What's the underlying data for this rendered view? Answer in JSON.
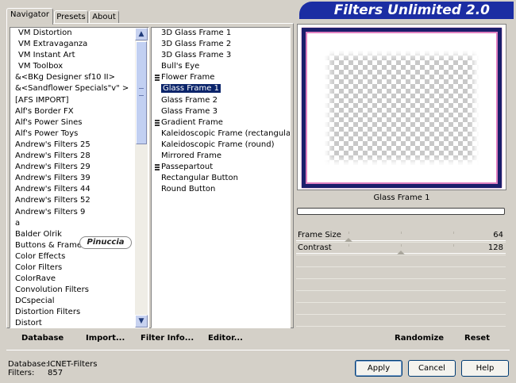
{
  "title": "Filters Unlimited 2.0",
  "tabs": [
    {
      "label": "Navigator",
      "active": true
    },
    {
      "label": "Presets",
      "active": false
    },
    {
      "label": "About",
      "active": false
    }
  ],
  "categories": [
    "VM Distortion",
    "VM Extravaganza",
    "VM Instant Art",
    "VM Toolbox",
    "&<BKg Designer sf10 II>",
    "&<Sandflower Specials\"v\" >",
    "[AFS IMPORT]",
    "Alf's Border FX",
    "Alf's Power Sines",
    "Alf's Power Toys",
    "Andrew's Filters 25",
    "Andrew's Filters 28",
    "Andrew's Filters 29",
    "Andrew's Filters 39",
    "Andrew's Filters 44",
    "Andrew's Filters 52",
    "Andrew's Filters 9",
    "a",
    "Balder Olrik",
    "Buttons & Frames",
    "Color Effects",
    "Color Filters",
    "ColorRave",
    "Convolution Filters",
    "DCspecial",
    "Distortion Filters",
    "Distort"
  ],
  "selected_category": "Buttons & Frames",
  "filters": [
    {
      "label": "3D Glass Frame 1",
      "group": false
    },
    {
      "label": "3D Glass Frame 2",
      "group": false
    },
    {
      "label": "3D Glass Frame 3",
      "group": false
    },
    {
      "label": "Bull's Eye",
      "group": false
    },
    {
      "label": "Flower Frame",
      "group": true
    },
    {
      "label": "Glass Frame 1",
      "group": false,
      "selected": true
    },
    {
      "label": "Glass Frame 2",
      "group": false
    },
    {
      "label": "Glass Frame 3",
      "group": false
    },
    {
      "label": "Gradient Frame",
      "group": true
    },
    {
      "label": "Kaleidoscopic Frame (rectangular)",
      "group": false
    },
    {
      "label": "Kaleidoscopic Frame (round)",
      "group": false
    },
    {
      "label": "Mirrored Frame",
      "group": false
    },
    {
      "label": "Passepartout",
      "group": true
    },
    {
      "label": "Rectangular Button",
      "group": false
    },
    {
      "label": "Round Button",
      "group": false
    }
  ],
  "watermark": "Pinuccia",
  "preview": {
    "filter_name": "Glass Frame 1",
    "frame_color": "#1b1d6b",
    "glow_color": "#e080c0"
  },
  "params": [
    {
      "label": "Frame Size",
      "value": "64",
      "level": 0.25
    },
    {
      "label": "Contrast",
      "value": "128",
      "level": 0.5
    }
  ],
  "left_buttons": {
    "database": "Database",
    "import": "Import...",
    "filter_info": "Filter Info...",
    "editor": "Editor..."
  },
  "right_buttons": {
    "randomize": "Randomize",
    "reset": "Reset"
  },
  "footer": {
    "database_label": "Database:",
    "database_value": "ICNET-Filters",
    "filters_label": "Filters:",
    "filters_value": "857"
  },
  "dialog_buttons": {
    "apply": "Apply",
    "cancel": "Cancel",
    "help": "Help"
  },
  "colors": {
    "title_bg": "#1b2da3",
    "selection": "#0a246a",
    "face": "#d4d0c8"
  }
}
